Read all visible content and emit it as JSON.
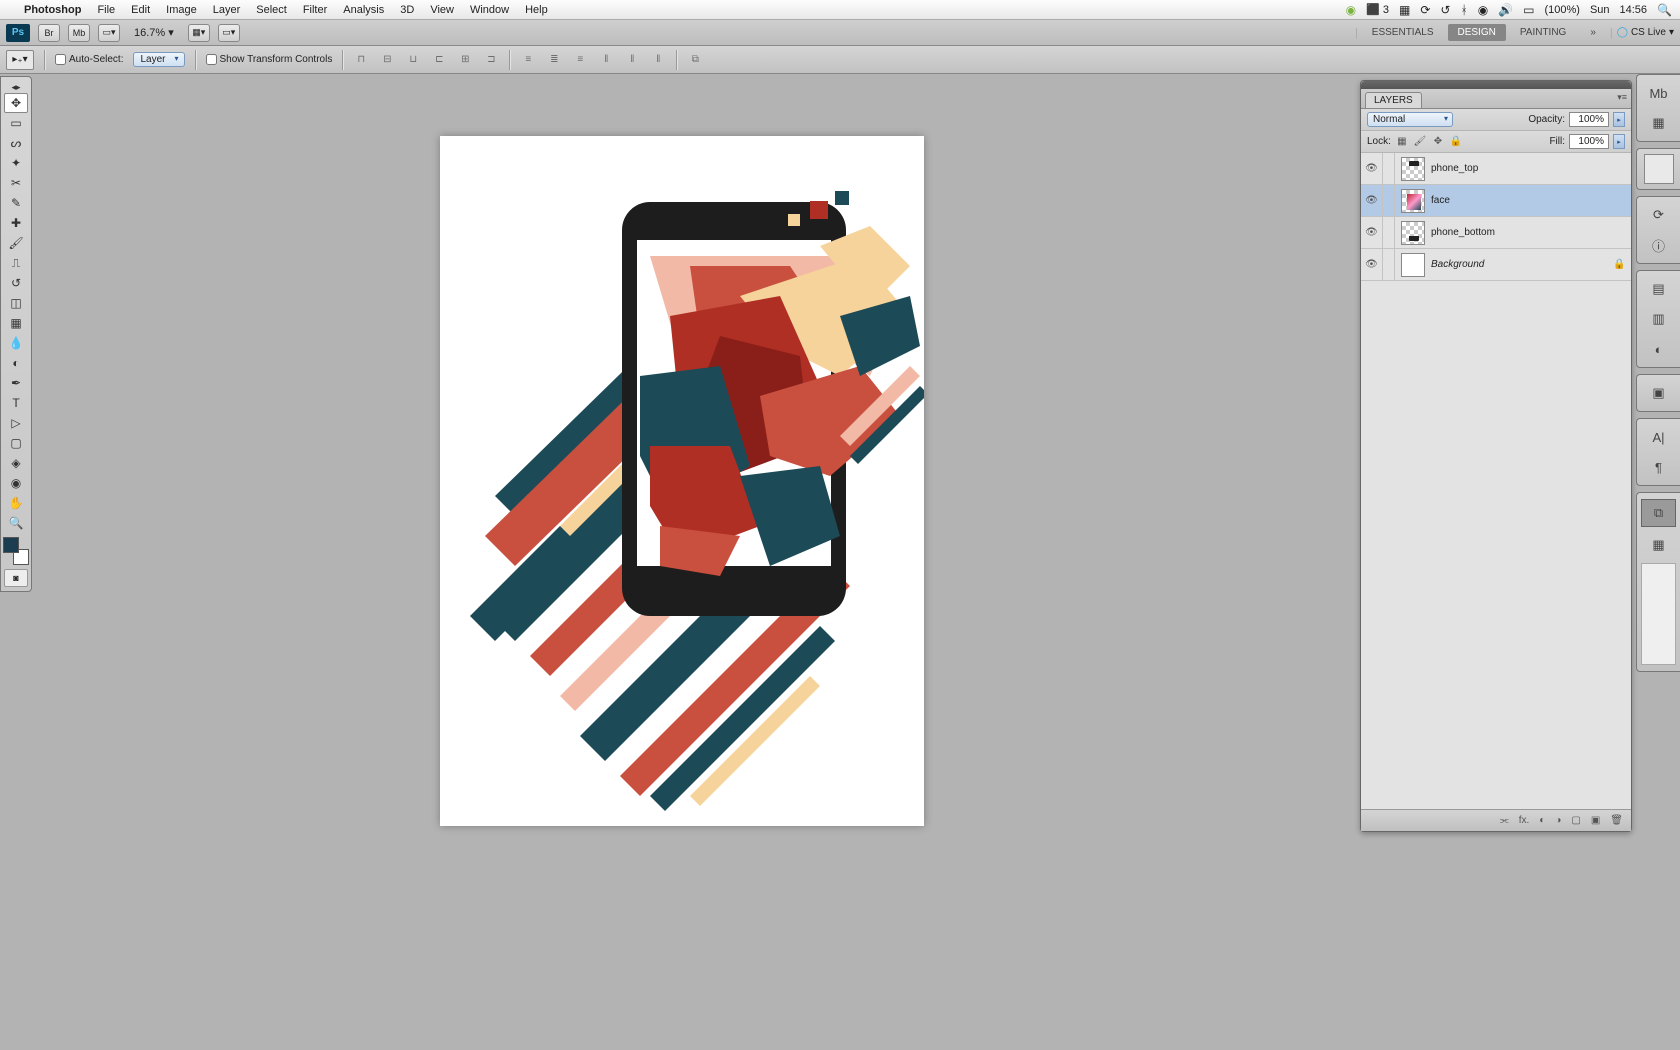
{
  "os_menubar": {
    "app": "Photoshop",
    "menus": [
      "File",
      "Edit",
      "Image",
      "Layer",
      "Select",
      "Filter",
      "Analysis",
      "3D",
      "View",
      "Window",
      "Help"
    ],
    "tray": {
      "adobe_n": "3",
      "battery": "(100%)",
      "day": "Sun",
      "time": "14:56"
    }
  },
  "app_bar": {
    "zoom": "16.7%",
    "workspaces": [
      "ESSENTIALS",
      "DESIGN",
      "PAINTING"
    ],
    "active_workspace": 1,
    "cslive": "CS Live"
  },
  "options": {
    "auto_select_label": "Auto-Select:",
    "auto_select_value": "Layer",
    "show_transform_label": "Show Transform Controls"
  },
  "layers_panel": {
    "tab": "LAYERS",
    "blend_mode": "Normal",
    "opacity_label": "Opacity:",
    "opacity_value": "100%",
    "lock_label": "Lock:",
    "fill_label": "Fill:",
    "fill_value": "100%",
    "layers": [
      {
        "name": "phone_top",
        "selected": false,
        "locked": false,
        "thumb": "phtop"
      },
      {
        "name": "face",
        "selected": true,
        "locked": false,
        "thumb": "face"
      },
      {
        "name": "phone_bottom",
        "selected": false,
        "locked": false,
        "thumb": "phbot"
      },
      {
        "name": "Background",
        "selected": false,
        "locked": true,
        "italic": true,
        "thumb": "white"
      }
    ]
  },
  "colors": {
    "fg": "#1b3d4f",
    "bg": "#ffffff"
  }
}
